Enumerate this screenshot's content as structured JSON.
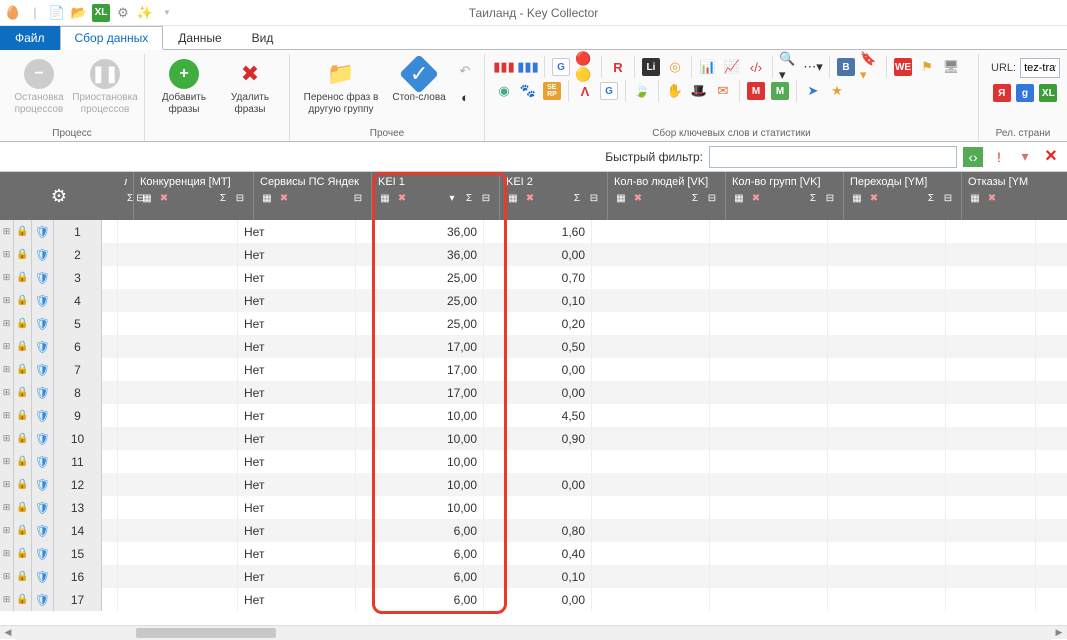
{
  "window": {
    "title": "Таиланд - Key Collector"
  },
  "tabs": {
    "file": "Файл",
    "collect": "Сбор данных",
    "data": "Данные",
    "view": "Вид"
  },
  "ribbon": {
    "process_group": "Процесс",
    "other_group": "Прочее",
    "stats_group": "Сбор ключевых слов и статистики",
    "rel_pages": "Рел. страни",
    "stop_proc": "Остановка\nпроцессов",
    "pause_proc": "Приостановка\nпроцессов",
    "add_phrase": "Добавить\nфразы",
    "del_phrase": "Удалить\nфразы",
    "move_phrase": "Перенос фраз в\nдругую группу",
    "stop_words": "Стоп-слова",
    "url_label": "URL:",
    "url_value": "tez-trav"
  },
  "filter": {
    "label": "Быстрый фильтр:",
    "value": ""
  },
  "columns": {
    "comp": "Конкуренция [MT]",
    "yserv": "Сервисы ПС Яндек",
    "kei1": "KEI 1",
    "kei2": "KEI 2",
    "vkp": "Кол-во людей [VK]",
    "vkg": "Кол-во групп [VK]",
    "ym": "Переходы [YM]",
    "refuse": "Отказы [YM"
  },
  "col_trunc": "л",
  "rows": [
    {
      "n": "1",
      "yserv": "Нет",
      "kei1": "36,00",
      "kei2": "1,60"
    },
    {
      "n": "2",
      "yserv": "Нет",
      "kei1": "36,00",
      "kei2": "0,00"
    },
    {
      "n": "3",
      "yserv": "Нет",
      "kei1": "25,00",
      "kei2": "0,70"
    },
    {
      "n": "4",
      "yserv": "Нет",
      "kei1": "25,00",
      "kei2": "0,10"
    },
    {
      "n": "5",
      "yserv": "Нет",
      "kei1": "25,00",
      "kei2": "0,20"
    },
    {
      "n": "6",
      "yserv": "Нет",
      "kei1": "17,00",
      "kei2": "0,50"
    },
    {
      "n": "7",
      "yserv": "Нет",
      "kei1": "17,00",
      "kei2": "0,00"
    },
    {
      "n": "8",
      "yserv": "Нет",
      "kei1": "17,00",
      "kei2": "0,00"
    },
    {
      "n": "9",
      "yserv": "Нет",
      "kei1": "10,00",
      "kei2": "4,50"
    },
    {
      "n": "10",
      "yserv": "Нет",
      "kei1": "10,00",
      "kei2": "0,90"
    },
    {
      "n": "11",
      "yserv": "Нет",
      "kei1": "10,00",
      "kei2": ""
    },
    {
      "n": "12",
      "yserv": "Нет",
      "kei1": "10,00",
      "kei2": "0,00"
    },
    {
      "n": "13",
      "yserv": "Нет",
      "kei1": "10,00",
      "kei2": ""
    },
    {
      "n": "14",
      "yserv": "Нет",
      "kei1": "6,00",
      "kei2": "0,80"
    },
    {
      "n": "15",
      "yserv": "Нет",
      "kei1": "6,00",
      "kei2": "0,40"
    },
    {
      "n": "16",
      "yserv": "Нет",
      "kei1": "6,00",
      "kei2": "0,10"
    },
    {
      "n": "17",
      "yserv": "Нет",
      "kei1": "6,00",
      "kei2": "0,00"
    }
  ]
}
